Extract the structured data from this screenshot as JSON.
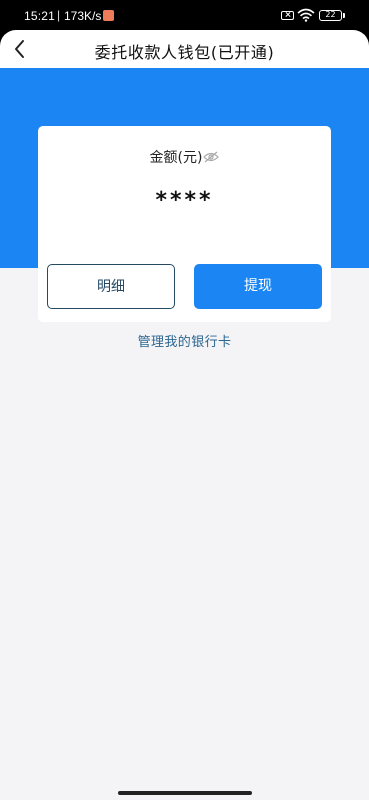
{
  "status_bar": {
    "time": "15:21",
    "separator": "|",
    "net_speed": "173K/s",
    "battery_level": "22",
    "notification_icon": "app-notification-icon",
    "sim_icon": "no-sim-icon",
    "wifi_icon": "wifi-icon"
  },
  "header": {
    "title": "委托收款人钱包(已开通)",
    "back_icon": "chevron-left-icon"
  },
  "wallet": {
    "amount_label": "金额(元)",
    "amount_value": "****",
    "visibility_icon": "eye-hidden-icon"
  },
  "actions": {
    "detail_label": "明细",
    "withdraw_label": "提现"
  },
  "links": {
    "manage_cards": "管理我的银行卡"
  },
  "colors": {
    "primary_blue": "#1b86f3",
    "link_blue": "#2b6690",
    "background": "#f4f3f6"
  }
}
